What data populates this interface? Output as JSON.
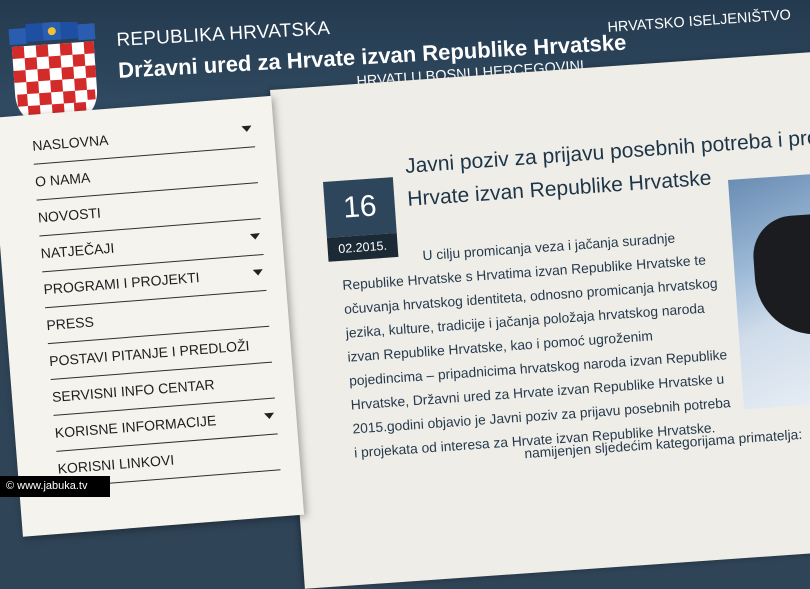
{
  "header": {
    "country": "REPUBLIKA HRVATSKA",
    "office": "Državni ured za Hrvate izvan Republike Hrvatske",
    "nav": [
      "HRVATSKO ISELJENIŠTVO",
      "HRVATI U BOSNI I HERCEGOVINI"
    ]
  },
  "sidebar": {
    "items": [
      {
        "label": "NASLOVNA"
      },
      {
        "label": "O NAMA"
      },
      {
        "label": "NOVOSTI"
      },
      {
        "label": "NATJEČAJI"
      },
      {
        "label": "PROGRAMI I PROJEKTI"
      },
      {
        "label": "PRESS"
      },
      {
        "label": "POSTAVI PITANJE I PREDLOŽI"
      },
      {
        "label": "SERVISNI INFO CENTAR"
      },
      {
        "label": "KORISNE INFORMACIJE"
      },
      {
        "label": "KORISNI LINKOVI"
      }
    ]
  },
  "article": {
    "date_day": "16",
    "date_full": "02.2015.",
    "title_line1": "Javni poziv za prijavu posebnih potreba i proj",
    "title_line2": "Hrvate izvan Republike Hrvatske",
    "body_lines": [
      "U cilju promicanja veza i jačanja suradnje",
      "Republike Hrvatske s Hrvatima izvan Republike Hrvatske te",
      "očuvanja hrvatskog identiteta, odnosno promicanja hrvatskog",
      "jezika, kulture, tradicije i jačanja položaja hrvatskog naroda",
      "izvan Republike Hrvatske, kao i pomoć ugroženim",
      "pojedincima – pripadnicima hrvatskog naroda izvan Republike",
      "Hrvatske, Državni ured za Hrvate izvan Republike Hrvatske u",
      "2015.godini objavio je Javni poziv za prijavu posebnih potreba",
      "i projekata od interesa za Hrvate izvan Republike Hrvatske."
    ],
    "body2_lines": [
      "namijenjen sljedećim kategorijama primatelja:",
      "poziv je namijenjen sljedećim kategorijama primatelja:"
    ]
  },
  "watermark": "www.jabuka.tv"
}
